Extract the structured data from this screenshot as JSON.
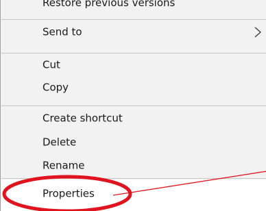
{
  "context_menu": {
    "items": [
      {
        "label": "Restore previous versions"
      },
      {
        "label": "Send to",
        "has_submenu": true
      },
      {
        "label": "Cut"
      },
      {
        "label": "Copy"
      },
      {
        "label": "Create shortcut"
      },
      {
        "label": "Delete"
      },
      {
        "label": "Rename"
      },
      {
        "label": "Properties",
        "highlighted": true
      }
    ]
  },
  "annotation": {
    "color": "#e0141e",
    "shape": "ellipse-with-pointer-line",
    "target": "Properties"
  }
}
